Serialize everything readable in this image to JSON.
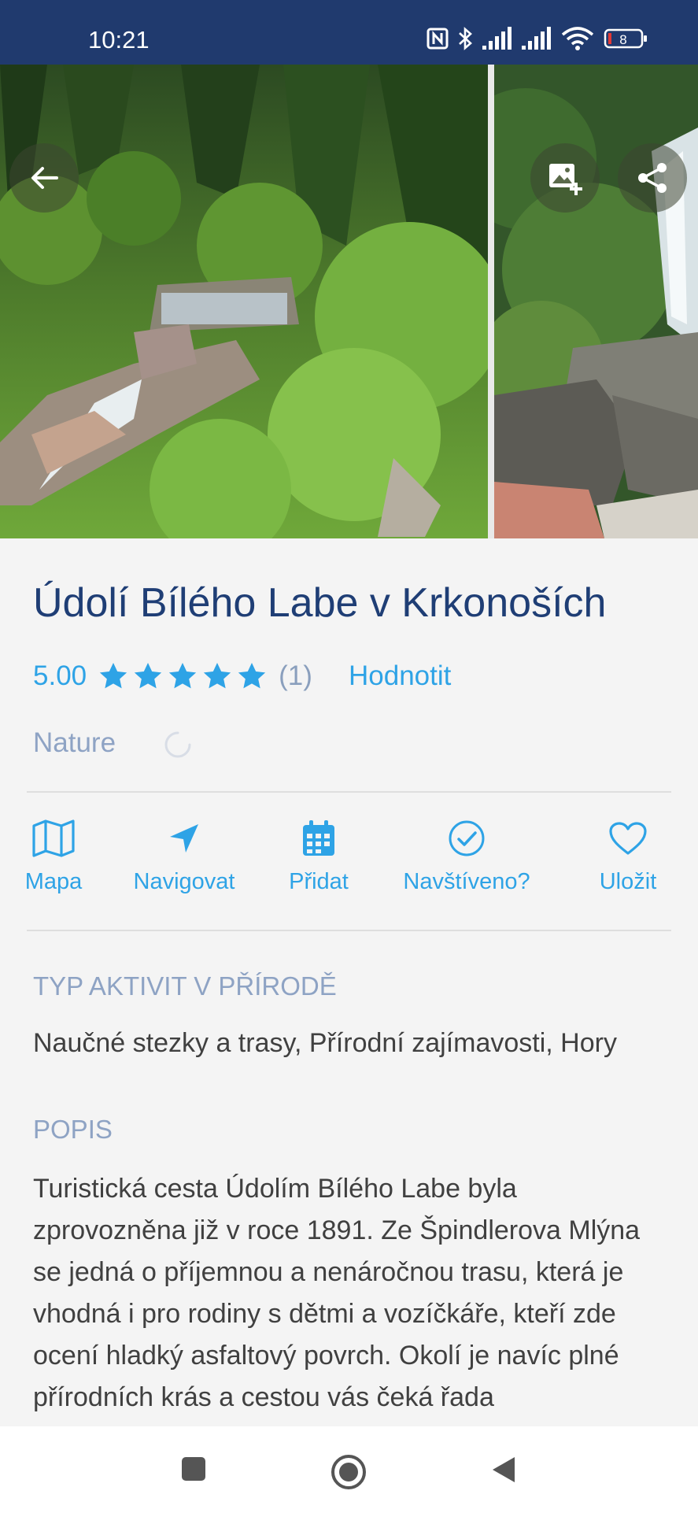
{
  "status_bar": {
    "time": "10:21",
    "battery": "8",
    "icons": [
      "nfc-icon",
      "bluetooth-icon",
      "signal-icon",
      "signal-icon",
      "wifi-icon",
      "battery-icon"
    ]
  },
  "gallery": {
    "buttons": [
      "back-arrow-icon",
      "add-photo-icon",
      "share-icon"
    ]
  },
  "place": {
    "title": "Údolí Bílého Labe v Krkonoších",
    "rating": "5.00",
    "stars": 5,
    "rating_count": "(1)",
    "rate_label": "Hodnotit",
    "category": "Nature"
  },
  "actions": [
    {
      "label": "Mapa",
      "icon": "map-icon"
    },
    {
      "label": "Navigovat",
      "icon": "navigate-icon"
    },
    {
      "label": "Přidat",
      "icon": "calendar-icon"
    },
    {
      "label": "Navštíveno?",
      "icon": "check-circle-icon"
    },
    {
      "label": "Uložit",
      "icon": "heart-icon"
    }
  ],
  "sections": {
    "activity_type": {
      "title": "TYP AKTIVIT V PŘÍRODĚ",
      "text": "Naučné stezky a trasy, Přírodní zajímavosti, Hory"
    },
    "description": {
      "title": "POPIS",
      "text": "Turistická cesta Údolím Bílého Labe byla zprovozněna již v roce 1891. Ze Špindlerova Mlýna se jedná o příjemnou a nenáročnou trasu, která je vhodná i pro rodiny s dětmi a vozíčkáře, kteří zde ocení hladký asfaltový povrch. Okolí je navíc plné přírodních krás a cestou vás čeká řada"
    }
  },
  "colors": {
    "status_bar": "#203a6e",
    "title": "#1f3e75",
    "accent": "#2ea3e6",
    "muted": "#8ea3c4",
    "body_text": "#404040",
    "background": "#f4f4f4"
  }
}
